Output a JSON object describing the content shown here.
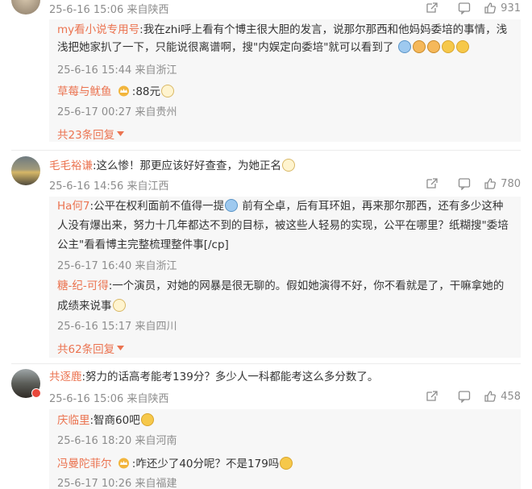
{
  "comments": [
    {
      "meta": "25-6-16 15:06 来自陕西",
      "likes": "931",
      "replies": [
        {
          "username": "my看小说专用号",
          "text_line1": ":我在zhi呼上看有个博主很大胆的发言，说那尔那西和他妈妈委培的事情，浅",
          "text_line2": "浅把她家扒了一下，只能说很离谱啊，搜\"内娱定向委培\"就可以看到了",
          "meta": "25-6-16 15:44 来自浙江"
        },
        {
          "username": "草莓与鱿鱼",
          "text": ":88元",
          "meta": "25-6-17 00:27 来自贵州"
        }
      ],
      "more_label": "共23条回复"
    },
    {
      "username": "毛毛裕谦",
      "text": ":这么惨！那更应该好好查查，为她正名",
      "meta": "25-6-16 14:56 来自江西",
      "likes": "780",
      "replies": [
        {
          "username": "Ha何7",
          "text_line1": ":公平在权利面前不值得一提",
          "text_line1b": "前有仝卓，后有耳环姐，再来那尔那西，还有多少这种",
          "text_line2": "人没有爆出来，努力十几年都达不到的目标，被这些人轻易的实现，公平在哪里？纸糊搜\"委培",
          "text_line3": "公主\"看看博主完整梳理整件事[/cp]",
          "meta": "25-6-17 16:40 来自浙江"
        },
        {
          "username": "糖-纪-可得",
          "text_line1": ":一个演员，对她的网暴是很无聊的。假如她演得不好，你不看就是了，干嘛拿她的",
          "text_line2": "成绩来说事",
          "meta": "25-6-16 15:17 来自四川"
        }
      ],
      "more_label": "共62条回复"
    },
    {
      "username": "共逐鹿",
      "text": ":努力的话高考能考139分？多少人一科都能考这么多分数了。",
      "meta": "25-6-16 15:06 来自陕西",
      "likes": "458",
      "replies": [
        {
          "username": "庆临里",
          "text": ":智商60吧",
          "meta": "25-6-16 18:20 来自河南"
        },
        {
          "username": "冯曼陀菲尔",
          "text": ":咋还少了40分呢？不是179吗",
          "meta": "25-6-17 10:26 来自福建"
        }
      ]
    }
  ],
  "colors": {
    "username": "#eb7350",
    "meta": "#8d8d8d",
    "reply_bg": "#f7f7f7"
  }
}
